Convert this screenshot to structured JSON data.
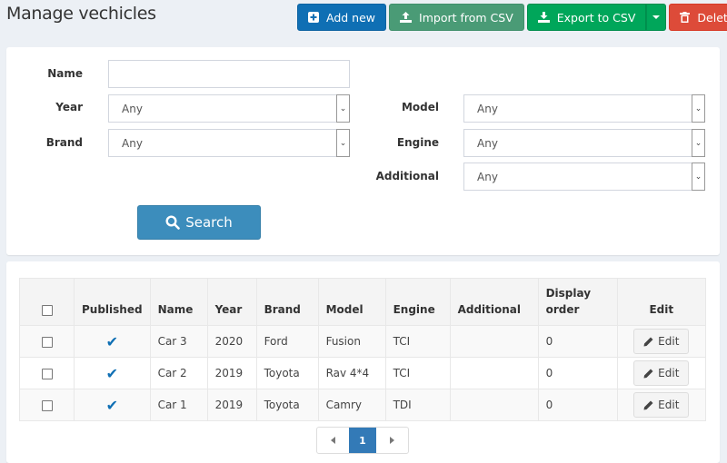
{
  "header": {
    "title": "Manage vechicles"
  },
  "toolbar": {
    "add_new": "Add new",
    "import_csv": "Import from CSV",
    "export_csv": "Export to CSV",
    "delete": "Delete"
  },
  "colors": {
    "add_new": "#0f6fb4",
    "import_csv": "#4a9b76",
    "export_csv": "#00a65a",
    "delete": "#dd4b39",
    "search": "#3c8dbc",
    "check": "#0f6fb4",
    "page_active": "#337ab7"
  },
  "search": {
    "name_label": "Name",
    "name_value": "",
    "year_label": "Year",
    "year_value": "Any",
    "brand_label": "Brand",
    "brand_value": "Any",
    "model_label": "Model",
    "model_value": "Any",
    "engine_label": "Engine",
    "engine_value": "Any",
    "additional_label": "Additional",
    "additional_value": "Any",
    "button_label": "Search"
  },
  "table": {
    "columns": {
      "published": "Published",
      "name": "Name",
      "year": "Year",
      "brand": "Brand",
      "model": "Model",
      "engine": "Engine",
      "additional": "Additional",
      "display_order_1": "Display",
      "display_order_2": "order",
      "edit": "Edit"
    },
    "rows": [
      {
        "published": true,
        "name": "Car 3",
        "year": "2020",
        "brand": "Ford",
        "model": "Fusion",
        "engine": "TCI",
        "additional": "",
        "display_order": "0",
        "edit_label": "Edit"
      },
      {
        "published": true,
        "name": "Car 2",
        "year": "2019",
        "brand": "Toyota",
        "model": "Rav 4*4",
        "engine": "TCI",
        "additional": "",
        "display_order": "0",
        "edit_label": "Edit"
      },
      {
        "published": true,
        "name": "Car 1",
        "year": "2019",
        "brand": "Toyota",
        "model": "Camry",
        "engine": "TDI",
        "additional": "",
        "display_order": "0",
        "edit_label": "Edit"
      }
    ]
  },
  "pagination": {
    "current_page": "1"
  }
}
